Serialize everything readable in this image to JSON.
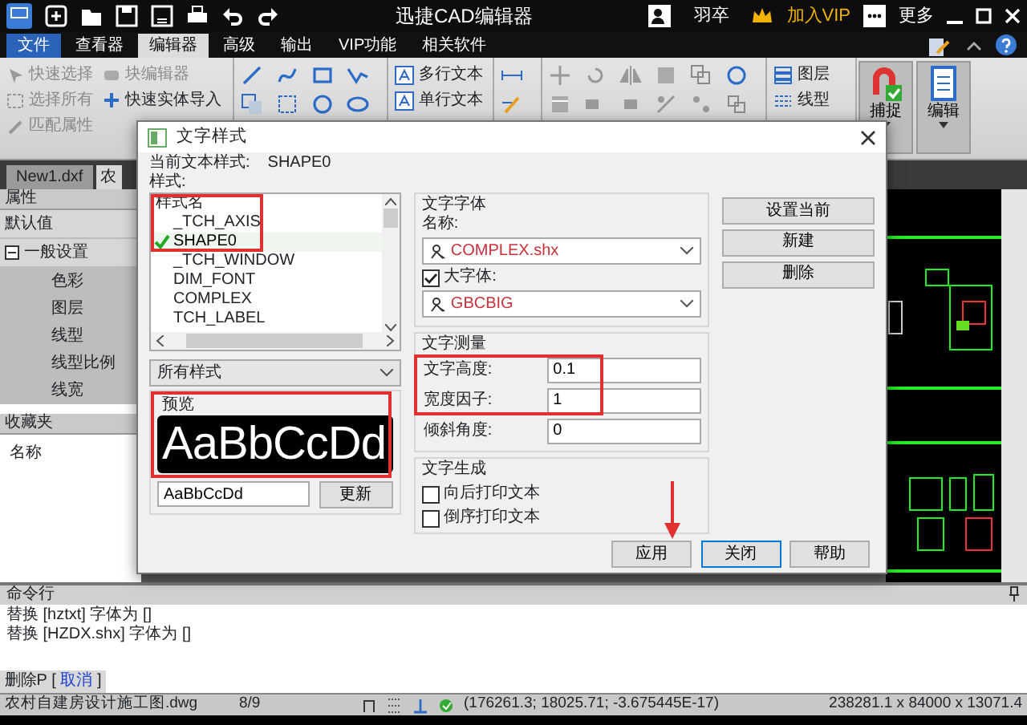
{
  "title_bar": {
    "app_title": "迅捷CAD编辑器",
    "user": "羽卒",
    "vip": "加入VIP",
    "more": "更多"
  },
  "menu_tabs": [
    {
      "label": "文件",
      "kind": "file",
      "selected": false
    },
    {
      "label": "查看器",
      "kind": "tab",
      "selected": false
    },
    {
      "label": "编辑器",
      "kind": "tab",
      "selected": true
    },
    {
      "label": "高级",
      "kind": "tab",
      "selected": false
    },
    {
      "label": "输出",
      "kind": "tab",
      "selected": false
    },
    {
      "label": "VIP功能",
      "kind": "tab",
      "selected": false
    },
    {
      "label": "相关软件",
      "kind": "tab",
      "selected": false
    }
  ],
  "ribbon": {
    "select_items": [
      {
        "label": "快速选择",
        "disabled": true
      },
      {
        "label": "选择所有",
        "disabled": true
      },
      {
        "label": "匹配属性",
        "disabled": true
      },
      {
        "label": "块编辑器",
        "disabled": true
      },
      {
        "label": "快速实体导入",
        "disabled": false
      }
    ],
    "text_items": [
      "多行文本",
      "单行文本"
    ],
    "layer_items": [
      "图层",
      "线型"
    ],
    "big_buttons": [
      "捕捉",
      "编辑"
    ]
  },
  "doc_tabs": [
    {
      "label": "New1.dxf",
      "selected": false
    },
    {
      "label": "农",
      "selected": true
    }
  ],
  "properties": {
    "title": "属性",
    "default": "默认值",
    "group": {
      "label": "一般设置",
      "expanded": true,
      "children": [
        {
          "label": "色彩"
        },
        {
          "label": "图层"
        },
        {
          "label": "线型"
        },
        {
          "label": "线型比例"
        },
        {
          "label": "线宽"
        }
      ]
    }
  },
  "favorites": {
    "title": "收藏夹",
    "column": "名称"
  },
  "dialog": {
    "title": "文字样式",
    "current_label": "当前文本样式:",
    "current_value": "SHAPE0",
    "styles_label": "样式:",
    "list_header": "样式名",
    "styles": [
      {
        "name": "_TCH_AXIS",
        "current": false
      },
      {
        "name": "SHAPE0",
        "current": true
      },
      {
        "name": "_TCH_WINDOW",
        "current": false
      },
      {
        "name": "DIM_FONT",
        "current": false
      },
      {
        "name": "COMPLEX",
        "current": false
      },
      {
        "name": "TCH_LABEL",
        "current": false
      }
    ],
    "filter": "所有样式",
    "preview_label": "预览",
    "preview_text": "AaBbCcDd",
    "sample_value": "AaBbCcDd",
    "update": "更新",
    "font": {
      "title": "文字字体",
      "name_label": "名称:",
      "name_value": "COMPLEX.shx",
      "bigfont": {
        "label": "大字体:",
        "checked": true
      },
      "bigfont_value": "GBCBIG"
    },
    "measure": {
      "title": "文字测量",
      "fields": [
        {
          "label": "文字高度:",
          "value": "0.1"
        },
        {
          "label": "宽度因子:",
          "value": "1"
        },
        {
          "label": "倾斜角度:",
          "value": "0"
        }
      ]
    },
    "generate": {
      "title": "文字生成",
      "options": [
        {
          "label": "向后打印文本",
          "checked": false
        },
        {
          "label": "倒序打印文本",
          "checked": false
        }
      ]
    },
    "side_buttons": [
      "设置当前",
      "新建",
      "删除"
    ],
    "buttons": [
      {
        "label": "应用",
        "default": false
      },
      {
        "label": "关闭",
        "default": true
      },
      {
        "label": "帮助",
        "default": false
      }
    ]
  },
  "command_line": {
    "title": "命令行",
    "lines": [
      "替换 [hztxt] 字体为 []",
      "替换 [HZDX.shx] 字体为 []"
    ],
    "prompt": "删除P",
    "prompt_open": "[",
    "option": "取消",
    "prompt_close": "]"
  },
  "status_bar": {
    "file": "农村自建房设计施工图.dwg",
    "page": "8/9",
    "coords": "(176261.3; 18025.71; -3.675445E-17)",
    "extents": "238281.1 x 84000 x 13071.4"
  }
}
